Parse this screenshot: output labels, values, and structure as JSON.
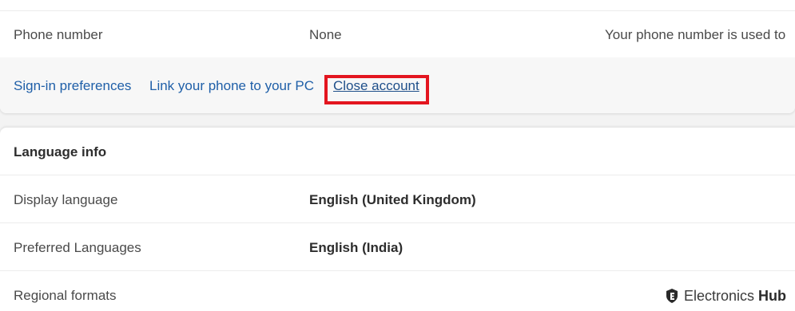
{
  "account": {
    "phone_row": {
      "label": "Phone number",
      "value": "None",
      "description": "Your phone number is used to"
    },
    "links": {
      "signin": "Sign-in preferences",
      "phone_pc": "Link your phone to your PC",
      "close": "Close account"
    }
  },
  "language_info": {
    "header": "Language info",
    "rows": [
      {
        "label": "Display language",
        "value": "English (United Kingdom)"
      },
      {
        "label": "Preferred Languages",
        "value": "English (India)"
      },
      {
        "label": "Regional formats",
        "value": ""
      }
    ]
  },
  "watermark": {
    "brand": "Electronics",
    "brand_bold": "Hub",
    "icon": "shield-e-icon"
  },
  "colors": {
    "link": "#1f5fa8",
    "highlight": "#e3151f"
  }
}
